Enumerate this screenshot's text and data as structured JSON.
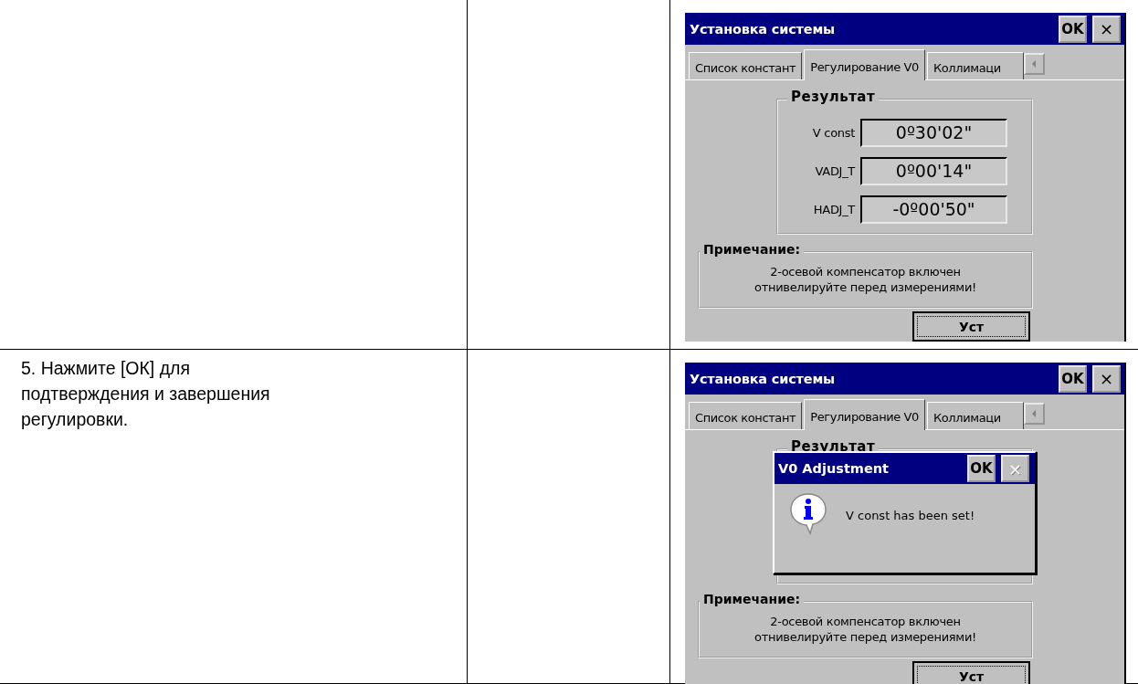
{
  "table": {
    "rows": [
      {
        "screen": {
          "title": "Установка системы",
          "title_buttons": [
            {
              "label": "OK",
              "kind": "ok",
              "disabled": false
            },
            {
              "label": "×",
              "kind": "close",
              "disabled": false
            }
          ],
          "tabs": [
            {
              "label": "Список констант",
              "selected": false
            },
            {
              "label": "Регулирование V0",
              "selected": true
            },
            {
              "label": "Коллимаци",
              "selected": false
            }
          ],
          "result": {
            "label": "Результат",
            "fields": [
              {
                "label": "V const",
                "value": "0º30'02\""
              },
              {
                "label": "VADJ_T",
                "value": "0º00'14\""
              },
              {
                "label": "HADJ_T",
                "value": "-0º00'50\""
              }
            ]
          },
          "note": {
            "label": "Примечание:",
            "lines": [
              "2-осевой компенсатор включен",
              "отнивелируйте перед измерениями!"
            ]
          },
          "button": "Уст"
        }
      },
      {
        "instruction": "5. Нажмите [ОК] для подтверждения и завершения регулировки.",
        "screen": {
          "title": "Установка системы",
          "title_buttons": [
            {
              "label": "OK",
              "kind": "ok",
              "disabled": false
            },
            {
              "label": "×",
              "kind": "close",
              "disabled": false
            }
          ],
          "tabs": [
            {
              "label": "Список констант",
              "selected": false
            },
            {
              "label": "Регулирование V0",
              "selected": true
            },
            {
              "label": "Коллимаци",
              "selected": false
            }
          ],
          "result": {
            "label": "Результат"
          },
          "note": {
            "label": "Примечание:",
            "lines": [
              "2-осевой компенсатор включен",
              "отнивелируйте перед измерениями!"
            ]
          },
          "button": "Уст",
          "dialog": {
            "title": "V0 Adjustment",
            "buttons": [
              {
                "label": "OK",
                "kind": "ok",
                "disabled": false
              },
              {
                "label": "×",
                "kind": "close",
                "disabled": true
              }
            ],
            "message": "V const has been set!"
          }
        }
      }
    ]
  }
}
